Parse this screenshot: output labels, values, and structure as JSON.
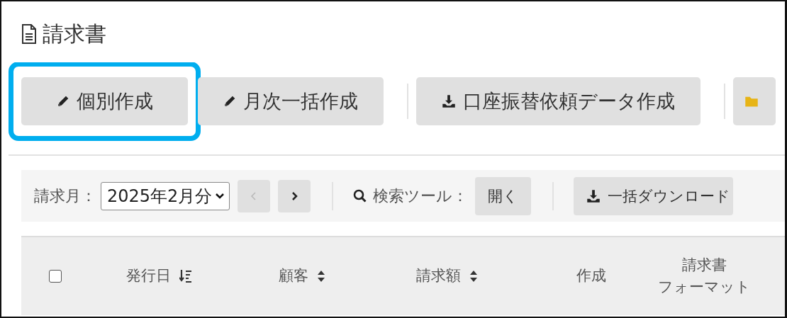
{
  "page": {
    "title": "請求書"
  },
  "toolbar": [
    {
      "kind": "pencil",
      "label": "個別作成",
      "highlighted": true
    },
    {
      "kind": "pencil",
      "label": "月次一括作成",
      "highlighted": false
    },
    {
      "kind": "download",
      "label": "口座振替依頼データ作成",
      "highlighted": false
    },
    {
      "kind": "folder",
      "highlighted": false
    }
  ],
  "filter": {
    "month_label": "請求月：",
    "month_value": "2025年2月分",
    "prev": {
      "disabled": true
    },
    "next": {
      "disabled": false
    },
    "search_label": "検索ツール：",
    "open_button": "開く",
    "download_button": "一括ダウンロード"
  },
  "table": {
    "columns": [
      {
        "kind": "checkbox",
        "checked": false
      },
      {
        "kind": "sorted",
        "label": "発行日"
      },
      {
        "kind": "sortable",
        "label": "顧客"
      },
      {
        "kind": "sortable",
        "label": "請求額"
      },
      {
        "kind": "plain",
        "label": "作成"
      },
      {
        "kind": "plain",
        "lines": [
          "請求書",
          "フォーマット"
        ]
      }
    ]
  }
}
